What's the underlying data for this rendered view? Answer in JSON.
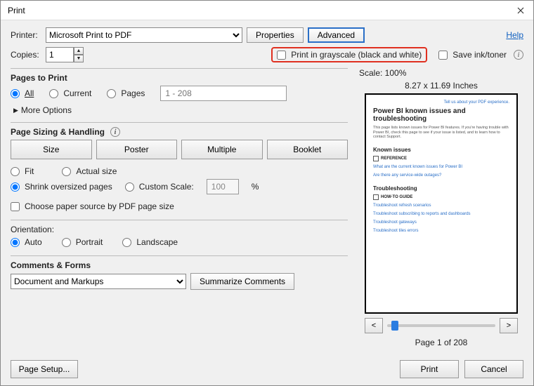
{
  "window": {
    "title": "Print"
  },
  "top": {
    "printer_label": "Printer:",
    "printer_value": "Microsoft Print to PDF",
    "properties_btn": "Properties",
    "advanced_btn": "Advanced",
    "help_link": "Help",
    "copies_label": "Copies:",
    "copies_value": "1",
    "grayscale_label": "Print in grayscale (black and white)",
    "save_ink_label": "Save ink/toner"
  },
  "pages": {
    "title": "Pages to Print",
    "all": "All",
    "current": "Current",
    "pages": "Pages",
    "range_placeholder": "1 - 208",
    "more_options": "More Options"
  },
  "sizing": {
    "title": "Page Sizing & Handling",
    "size_btn": "Size",
    "poster_btn": "Poster",
    "multiple_btn": "Multiple",
    "booklet_btn": "Booklet",
    "fit": "Fit",
    "actual": "Actual size",
    "shrink": "Shrink oversized pages",
    "custom": "Custom Scale:",
    "custom_value": "100",
    "pct": "%",
    "choose_paper": "Choose paper source by PDF page size"
  },
  "orientation": {
    "title": "Orientation:",
    "auto": "Auto",
    "portrait": "Portrait",
    "landscape": "Landscape"
  },
  "comments": {
    "title": "Comments & Forms",
    "value": "Document and Markups",
    "summarize": "Summarize Comments"
  },
  "preview": {
    "scale": "Scale: 100%",
    "dims": "8.27 x 11.69 Inches",
    "exp": "Tell us about your PDF experience.",
    "title": "Power BI known issues and troubleshooting",
    "desc": "This page lists known issues for Power BI features. If you're having trouble with Power BI, check this page to see if your issue is listed, and to learn how to contact Support.",
    "h1": "Known issues",
    "ref": "REFERENCE",
    "l1": "What are the current known issues for Power BI",
    "l2": "Are there any service-wide outages?",
    "h2": "Troubleshooting",
    "howto": "HOW-TO GUIDE",
    "l3": "Troubleshoot refresh scenarios",
    "l4": "Troubleshoot subscribing to reports and dashboards",
    "l5": "Troubleshoot gateways",
    "l6": "Troubleshoot tiles errors",
    "prev": "<",
    "next": ">",
    "page_of": "Page 1 of 208"
  },
  "footer": {
    "page_setup": "Page Setup...",
    "print": "Print",
    "cancel": "Cancel"
  }
}
